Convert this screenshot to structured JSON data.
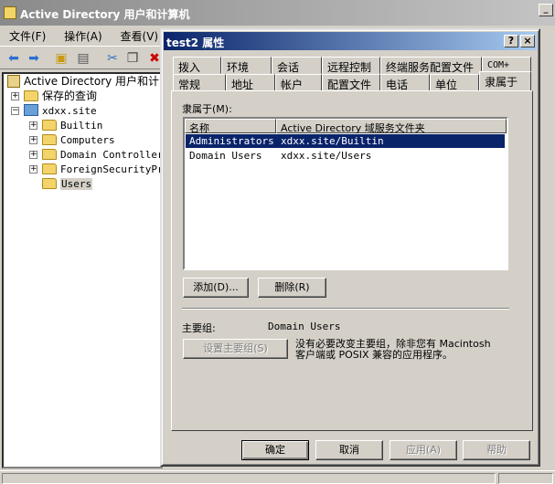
{
  "main_window": {
    "title": "Active Directory 用户和计算机",
    "menu": [
      "文件(F)",
      "操作(A)",
      "查看(V)"
    ],
    "minimize": "_"
  },
  "tree": {
    "root": "Active Directory 用户和计",
    "saved_queries": "保存的查询",
    "domain": "xdxx.site",
    "children": [
      "Builtin",
      "Computers",
      "Domain Controllers",
      "ForeignSecurityPri",
      "Users"
    ]
  },
  "dialog": {
    "title": "test2 属性",
    "help_btn": "?",
    "close_btn": "×",
    "tabs_back": [
      "拨入",
      "环境",
      "会话",
      "远程控制",
      "终端服务配置文件",
      "COM+"
    ],
    "tabs_front": [
      "常规",
      "地址",
      "帐户",
      "配置文件",
      "电话",
      "单位",
      "隶属于"
    ],
    "member_of_label": "隶属于(M):",
    "columns": [
      "名称",
      "Active Directory 域服务文件夹"
    ],
    "rows": [
      {
        "name": "Administrators",
        "folder": "xdxx.site/Builtin",
        "selected": true
      },
      {
        "name": "Domain Users",
        "folder": "xdxx.site/Users",
        "selected": false
      }
    ],
    "add_button": "添加(D)...",
    "remove_button": "删除(R)",
    "primary_group_label": "主要组:",
    "primary_group_value": "Domain Users",
    "set_primary_button": "设置主要组(S)",
    "note_line1": "没有必要改变主要组，除非您有 Macintosh",
    "note_line2": "客户端或 POSIX 兼容的应用程序。",
    "ok": "确定",
    "cancel": "取消",
    "apply": "应用(A)",
    "help": "帮助"
  },
  "colors": {
    "selection": "#0a246a",
    "title_active": "#0a246a",
    "face": "#d4d0c8"
  }
}
